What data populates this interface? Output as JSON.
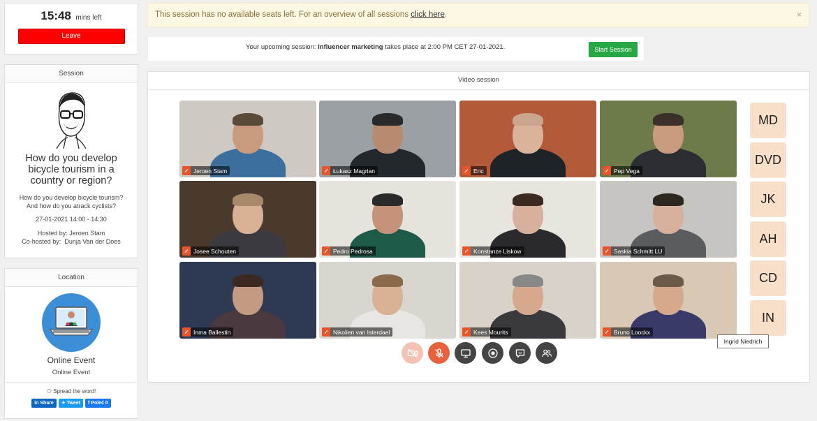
{
  "timer": {
    "time": "15:48",
    "suffix": "mins left",
    "leave_label": "Leave"
  },
  "session": {
    "header": "Session",
    "title": "How do you develop bicycle tourism in a country or region?",
    "description_line1": "How do you develop bicycle tourism?",
    "description_line2": "And how do you atrack cyclists?",
    "datetime": "27-01-2021 14:00 - 14:30",
    "hosted_by": "Hosted by: Jeroen Stam",
    "cohosted_label": "Co-hosted by:",
    "cohosted_name": "Dunja Van der Does"
  },
  "location": {
    "header": "Location",
    "name": "Online Event",
    "subtitle": "Online Event",
    "spread": "Spread the word!",
    "share": {
      "linkedin": "Share",
      "twitter": "Tweet",
      "facebook": "Poleć 0"
    }
  },
  "alert": {
    "text": "This session has no available seats left. For an overview of all sessions ",
    "link": "click here",
    "end": ".",
    "close": "×"
  },
  "upcoming": {
    "prefix": "Your upcoming session: ",
    "name": "Influencer marketing",
    "suffix": " takes place at 2:00 PM CET 27-01-2021.",
    "button": "Start Session"
  },
  "video": {
    "header": "Video session",
    "participants": [
      {
        "name": "Jeroen Stam",
        "bg": "#cfc9c4",
        "skin": "#c99b7e",
        "shirt": "#3d6f9c",
        "hair": "#5a4a3a"
      },
      {
        "name": "Łukasz Magrian",
        "bg": "#9aa0a3",
        "skin": "#b88a70",
        "shirt": "#23282c",
        "hair": "#2a2a2a"
      },
      {
        "name": "Eric",
        "bg": "#b35a3a",
        "skin": "#d9b39a",
        "shirt": "#1e2328",
        "hair": "#c9a68d"
      },
      {
        "name": "Pep Vega",
        "bg": "#6d7a4a",
        "skin": "#c99b7e",
        "shirt": "#2a2d31",
        "hair": "#3a3028"
      },
      {
        "name": "Josee Schouten",
        "bg": "#4a3a2e",
        "skin": "#d8b094",
        "shirt": "#3a3a40",
        "hair": "#a88a6a"
      },
      {
        "name": "Pedro Pedrosa",
        "bg": "#e6e2dc",
        "skin": "#c6937a",
        "shirt": "#1e5a4a",
        "hair": "#2a2a2a"
      },
      {
        "name": "Konstanze Liskow",
        "bg": "#e8e4de",
        "skin": "#d6b09a",
        "shirt": "#2a2a2e",
        "hair": "#3a2a22"
      },
      {
        "name": "Saskia Schmitt LU",
        "bg": "#c7c5c2",
        "skin": "#d6b09a",
        "shirt": "#5a5c60",
        "hair": "#2e2620"
      },
      {
        "name": "Inma Ballestin",
        "bg": "#2e3a54",
        "skin": "#c49a82",
        "shirt": "#4a3a40",
        "hair": "#3a2a22"
      },
      {
        "name": "Nikolien van Isterdael",
        "bg": "#d9d6d0",
        "skin": "#d8b094",
        "shirt": "#e8e6e2",
        "hair": "#8a6a4a"
      },
      {
        "name": "Kees Mourits",
        "bg": "#d8d2c8",
        "skin": "#d6a88c",
        "shirt": "#3a3a3e",
        "hair": "#888"
      },
      {
        "name": "Bruno Loockx",
        "bg": "#d8c8b4",
        "skin": "#d6a88c",
        "shirt": "#3a3a6a",
        "hair": "#6a5a4a"
      }
    ],
    "avatars": [
      "MD",
      "DVD",
      "JK",
      "AH",
      "CD",
      "IN"
    ],
    "tooltip": "Ingrid Niedrich"
  }
}
